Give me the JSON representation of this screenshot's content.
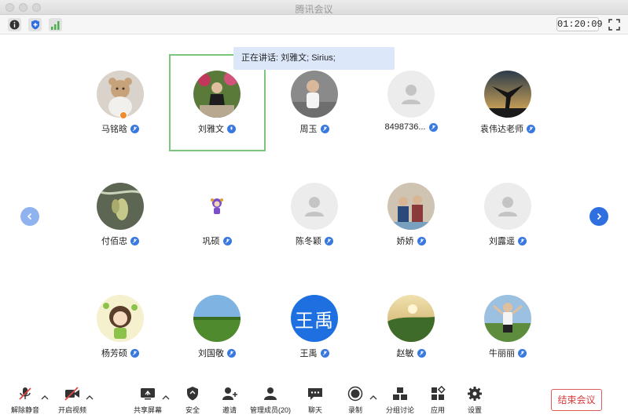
{
  "window": {
    "title": "腾讯会议"
  },
  "top_toolbar": {
    "icons": [
      "info-icon",
      "security-shield-icon",
      "signal-icon"
    ],
    "timer": "01:20:09",
    "fullscreen_icon": "fullscreen-icon"
  },
  "speaking_banner": "正在讲话: 刘雅文; Sirius;",
  "participants": [
    {
      "name": "马铭晗",
      "avatar": "teddy-bear-photo"
    },
    {
      "name": "刘雅文",
      "avatar": "woman-photo"
    },
    {
      "name": "周玉",
      "avatar": "child-photo"
    },
    {
      "name": "8498736...",
      "avatar": "default-person"
    },
    {
      "name": "袁伟达老师",
      "avatar": "silhouette-photo"
    },
    {
      "name": "付佰忠",
      "avatar": "orchid-photo"
    },
    {
      "name": "巩硕",
      "avatar": "cartoon-photo"
    },
    {
      "name": "陈冬颖",
      "avatar": "default-person"
    },
    {
      "name": "娇娇",
      "avatar": "family-photo"
    },
    {
      "name": "刘露遥",
      "avatar": "default-person"
    },
    {
      "name": "杨芳硕",
      "avatar": "cartoon-girl-photo"
    },
    {
      "name": "刘国敬",
      "avatar": "grassland-photo"
    },
    {
      "name": "王禹",
      "avatar": "text-avatar",
      "avatar_text": "王禹",
      "avatar_color": "#1e6fe0"
    },
    {
      "name": "赵敏",
      "avatar": "sunset-photo"
    },
    {
      "name": "牛丽丽",
      "avatar": "boy-photo"
    }
  ],
  "bottom_toolbar": {
    "unmute": "解除静音",
    "start_video": "开启视频",
    "share_screen": "共享屏幕",
    "security": "安全",
    "invite": "邀请",
    "manage_members": "管理成员(20)",
    "chat": "聊天",
    "record": "录制",
    "breakout": "分组讨论",
    "apps": "应用",
    "settings": "设置",
    "end_meeting": "结束会议"
  },
  "colors": {
    "accent": "#3978e0",
    "end": "#d83b3b",
    "active_speaker": "#7cc57c"
  }
}
